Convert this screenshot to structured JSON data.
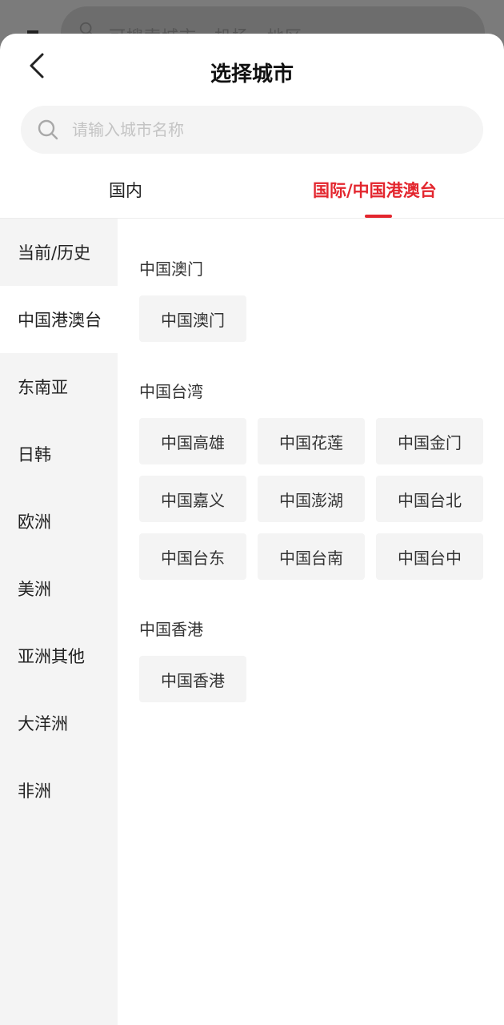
{
  "background": {
    "search_placeholder": "可搜索城市、机场、地区"
  },
  "header": {
    "title": "选择城市"
  },
  "search": {
    "placeholder": "请输入城市名称"
  },
  "tabs": [
    {
      "label": "国内",
      "active": false
    },
    {
      "label": "国际/中国港澳台",
      "active": true
    }
  ],
  "colors": {
    "accent": "#e3262e",
    "sidebar_bg": "#f4f4f4",
    "chip_bg": "#f4f4f4"
  },
  "sidebar": {
    "items": [
      {
        "label": "当前/历史",
        "active": false
      },
      {
        "label": "中国港澳台",
        "active": true
      },
      {
        "label": "东南亚",
        "active": false
      },
      {
        "label": "日韩",
        "active": false
      },
      {
        "label": "欧洲",
        "active": false
      },
      {
        "label": "美洲",
        "active": false
      },
      {
        "label": "亚洲其他",
        "active": false
      },
      {
        "label": "大洋洲",
        "active": false
      },
      {
        "label": "非洲",
        "active": false
      }
    ]
  },
  "sections": [
    {
      "title": "中国澳门",
      "cities": [
        "中国澳门"
      ]
    },
    {
      "title": "中国台湾",
      "cities": [
        "中国高雄",
        "中国花莲",
        "中国金门",
        "中国嘉义",
        "中国澎湖",
        "中国台北",
        "中国台东",
        "中国台南",
        "中国台中"
      ]
    },
    {
      "title": "中国香港",
      "cities": [
        "中国香港"
      ]
    }
  ]
}
